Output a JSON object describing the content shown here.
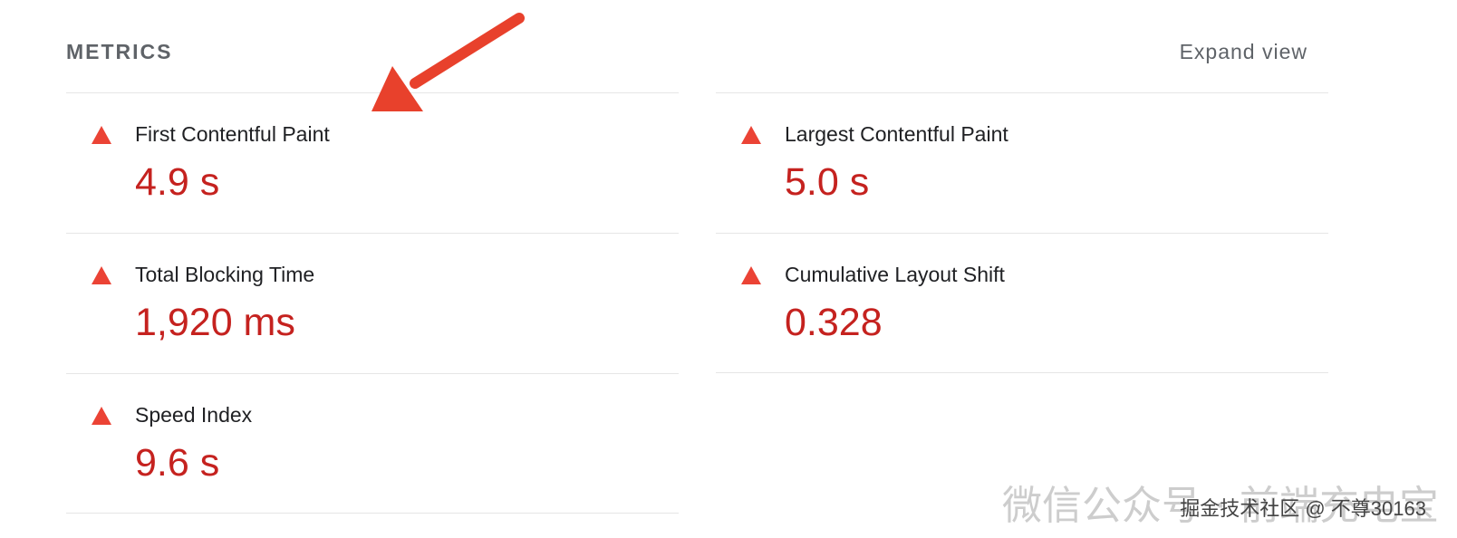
{
  "header": {
    "title": "METRICS",
    "expand_label": "Expand view"
  },
  "metrics": {
    "left": [
      {
        "label": "First Contentful Paint",
        "value": "4.9 s"
      },
      {
        "label": "Total Blocking Time",
        "value": "1,920 ms"
      },
      {
        "label": "Speed Index",
        "value": "9.6 s"
      }
    ],
    "right": [
      {
        "label": "Largest Contentful Paint",
        "value": "5.0 s"
      },
      {
        "label": "Cumulative Layout Shift",
        "value": "0.328"
      }
    ]
  },
  "status_icon": "fail-triangle-icon",
  "colors": {
    "fail": "#eb4335",
    "value": "#c5221f",
    "annotation_arrow": "#e8412c"
  },
  "watermark": {
    "main": "微信公众号 · 前端充电宝",
    "sub": "掘金技术社区 @ 不尊30163"
  }
}
